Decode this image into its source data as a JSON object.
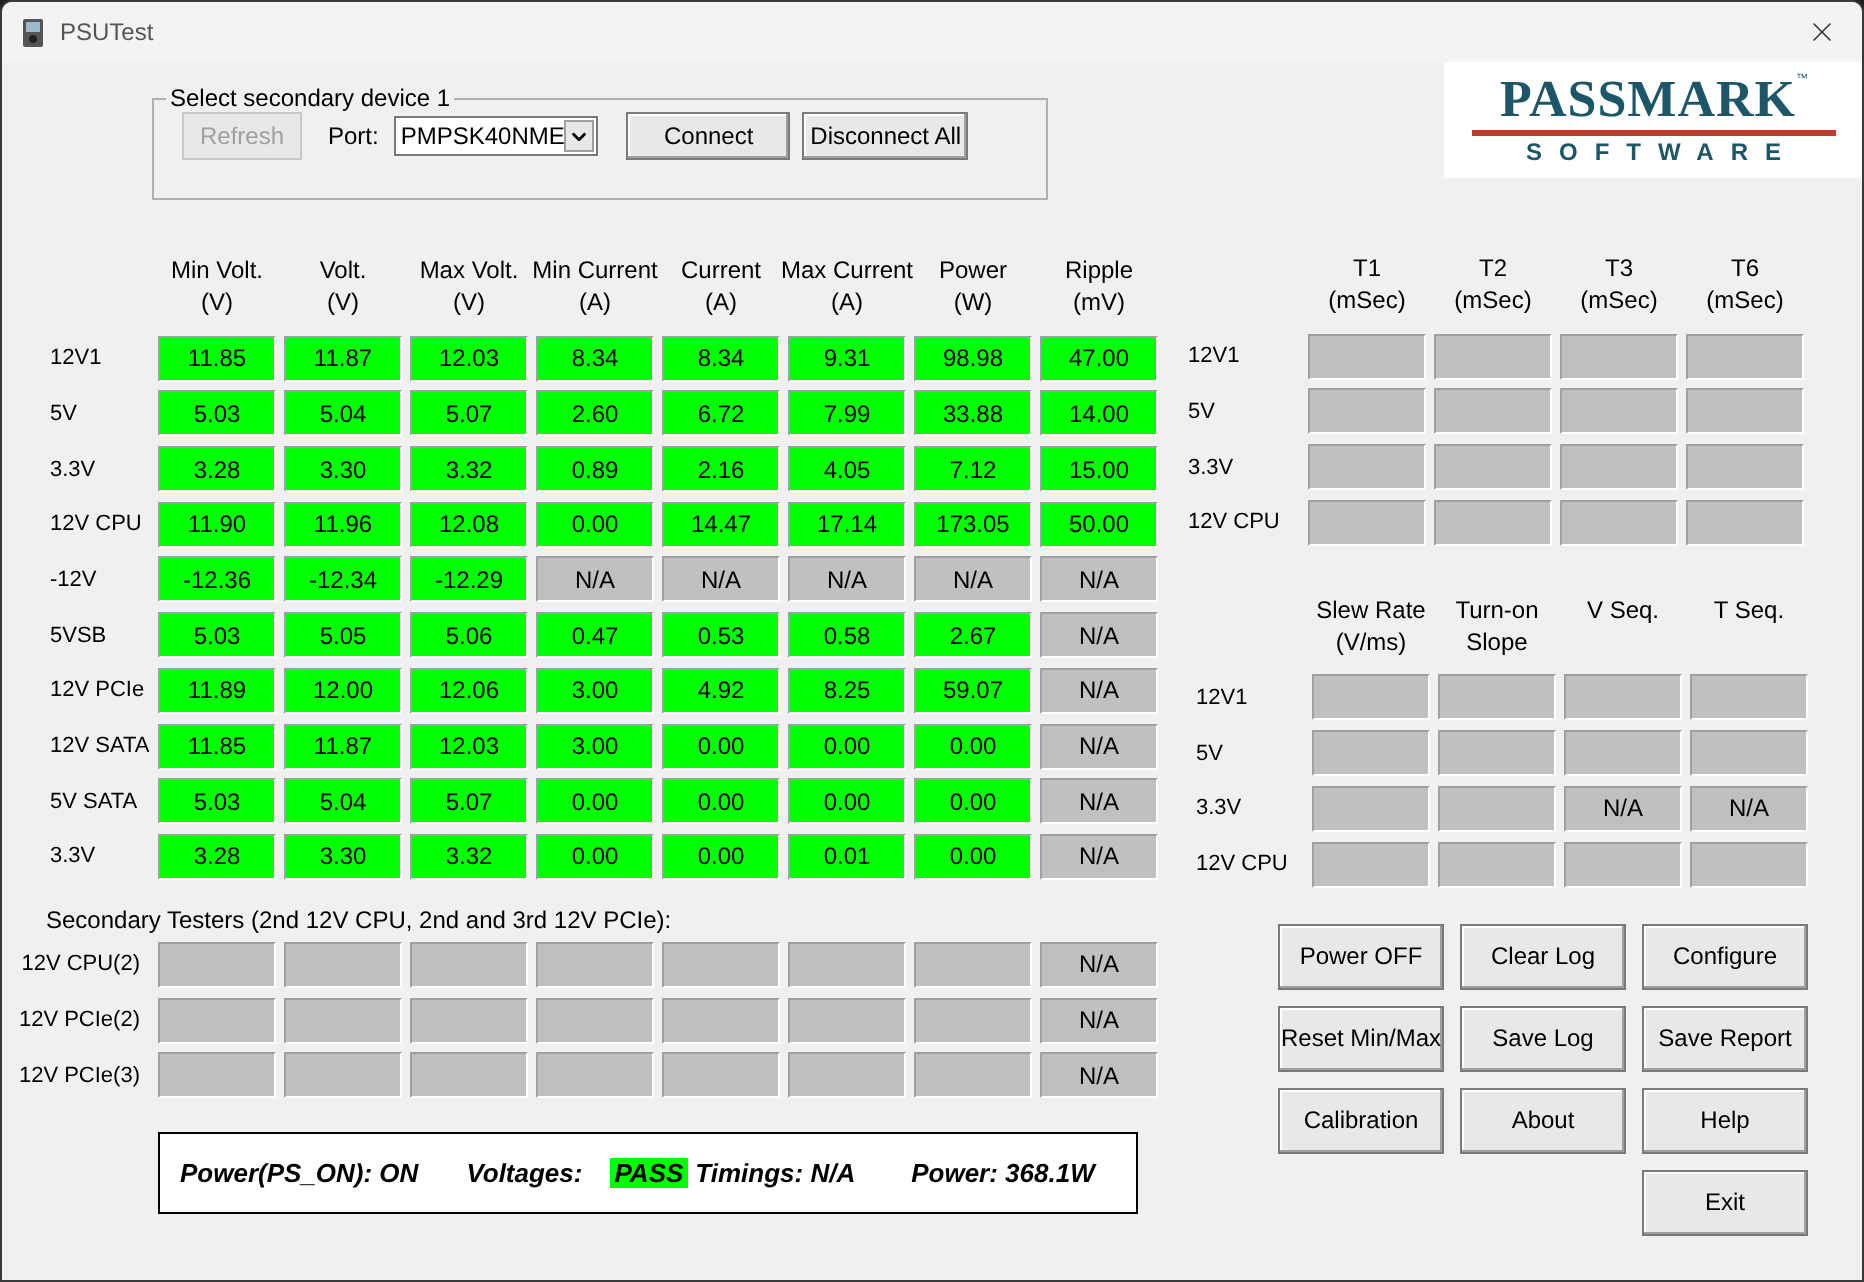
{
  "window": {
    "title": "PSUTest"
  },
  "device_group": {
    "title": "Select secondary device 1",
    "refresh": {
      "label": "Refresh",
      "disabled": true
    },
    "port_label": "Port:",
    "port_value": "PMPSK40NME",
    "connect": {
      "label": "Connect",
      "disabled": false
    },
    "disconnect": {
      "label": "Disconnect All",
      "disabled": false
    }
  },
  "logo": {
    "name": "PASSMARK",
    "mark": "™",
    "tagline": "SOFTWARE"
  },
  "readings": {
    "columns": [
      {
        "line1": "Min Volt.",
        "line2": "(V)"
      },
      {
        "line1": "Volt.",
        "line2": "(V)"
      },
      {
        "line1": "Max Volt.",
        "line2": "(V)"
      },
      {
        "line1": "Min Current",
        "line2": "(A)"
      },
      {
        "line1": "Current",
        "line2": "(A)"
      },
      {
        "line1": "Max Current",
        "line2": "(A)"
      },
      {
        "line1": "Power",
        "line2": "(W)"
      },
      {
        "line1": "Ripple",
        "line2": "(mV)"
      }
    ],
    "rows": [
      {
        "label": "12V1",
        "cells": [
          {
            "value": "11.85",
            "passed": true
          },
          {
            "value": "11.87",
            "passed": true
          },
          {
            "value": "12.03",
            "passed": true
          },
          {
            "value": "8.34",
            "passed": true
          },
          {
            "value": "8.34",
            "passed": true
          },
          {
            "value": "9.31",
            "passed": true
          },
          {
            "value": "98.98",
            "passed": true
          },
          {
            "value": "47.00",
            "passed": true
          }
        ]
      },
      {
        "label": "5V",
        "cells": [
          {
            "value": "5.03",
            "passed": true
          },
          {
            "value": "5.04",
            "passed": true
          },
          {
            "value": "5.07",
            "passed": true
          },
          {
            "value": "2.60",
            "passed": true
          },
          {
            "value": "6.72",
            "passed": true
          },
          {
            "value": "7.99",
            "passed": true
          },
          {
            "value": "33.88",
            "passed": true
          },
          {
            "value": "14.00",
            "passed": true
          }
        ]
      },
      {
        "label": "3.3V",
        "cells": [
          {
            "value": "3.28",
            "passed": true
          },
          {
            "value": "3.30",
            "passed": true
          },
          {
            "value": "3.32",
            "passed": true
          },
          {
            "value": "0.89",
            "passed": true
          },
          {
            "value": "2.16",
            "passed": true
          },
          {
            "value": "4.05",
            "passed": true
          },
          {
            "value": "7.12",
            "passed": true
          },
          {
            "value": "15.00",
            "passed": true
          }
        ]
      },
      {
        "label": "12V CPU",
        "cells": [
          {
            "value": "11.90",
            "passed": true
          },
          {
            "value": "11.96",
            "passed": true
          },
          {
            "value": "12.08",
            "passed": true
          },
          {
            "value": "0.00",
            "passed": true
          },
          {
            "value": "14.47",
            "passed": true
          },
          {
            "value": "17.14",
            "passed": true
          },
          {
            "value": "173.05",
            "passed": true
          },
          {
            "value": "50.00",
            "passed": true
          }
        ]
      },
      {
        "label": "-12V",
        "cells": [
          {
            "value": "-12.36",
            "passed": true
          },
          {
            "value": "-12.34",
            "passed": true
          },
          {
            "value": "-12.29",
            "passed": true
          },
          {
            "value": "N/A",
            "passed": false
          },
          {
            "value": "N/A",
            "passed": false
          },
          {
            "value": "N/A",
            "passed": false
          },
          {
            "value": "N/A",
            "passed": false
          },
          {
            "value": "N/A",
            "passed": false
          }
        ]
      },
      {
        "label": "5VSB",
        "cells": [
          {
            "value": "5.03",
            "passed": true
          },
          {
            "value": "5.05",
            "passed": true
          },
          {
            "value": "5.06",
            "passed": true
          },
          {
            "value": "0.47",
            "passed": true
          },
          {
            "value": "0.53",
            "passed": true
          },
          {
            "value": "0.58",
            "passed": true
          },
          {
            "value": "2.67",
            "passed": true
          },
          {
            "value": "N/A",
            "passed": false
          }
        ]
      },
      {
        "label": "12V PCIe",
        "cells": [
          {
            "value": "11.89",
            "passed": true
          },
          {
            "value": "12.00",
            "passed": true
          },
          {
            "value": "12.06",
            "passed": true
          },
          {
            "value": "3.00",
            "passed": true
          },
          {
            "value": "4.92",
            "passed": true
          },
          {
            "value": "8.25",
            "passed": true
          },
          {
            "value": "59.07",
            "passed": true
          },
          {
            "value": "N/A",
            "passed": false
          }
        ]
      },
      {
        "label": "12V SATA",
        "cells": [
          {
            "value": "11.85",
            "passed": true
          },
          {
            "value": "11.87",
            "passed": true
          },
          {
            "value": "12.03",
            "passed": true
          },
          {
            "value": "3.00",
            "passed": true
          },
          {
            "value": "0.00",
            "passed": true
          },
          {
            "value": "0.00",
            "passed": true
          },
          {
            "value": "0.00",
            "passed": true
          },
          {
            "value": "N/A",
            "passed": false
          }
        ]
      },
      {
        "label": "5V SATA",
        "cells": [
          {
            "value": "5.03",
            "passed": true
          },
          {
            "value": "5.04",
            "passed": true
          },
          {
            "value": "5.07",
            "passed": true
          },
          {
            "value": "0.00",
            "passed": true
          },
          {
            "value": "0.00",
            "passed": true
          },
          {
            "value": "0.00",
            "passed": true
          },
          {
            "value": "0.00",
            "passed": true
          },
          {
            "value": "N/A",
            "passed": false
          }
        ]
      },
      {
        "label": "3.3V",
        "cells": [
          {
            "value": "3.28",
            "passed": true
          },
          {
            "value": "3.30",
            "passed": true
          },
          {
            "value": "3.32",
            "passed": true
          },
          {
            "value": "0.00",
            "passed": true
          },
          {
            "value": "0.00",
            "passed": true
          },
          {
            "value": "0.01",
            "passed": true
          },
          {
            "value": "0.00",
            "passed": true
          },
          {
            "value": "N/A",
            "passed": false
          }
        ]
      }
    ]
  },
  "secondary": {
    "caption": "Secondary Testers (2nd 12V CPU, 2nd and 3rd 12V PCIe):",
    "rows": [
      {
        "label": "12V CPU(2)",
        "cells": [
          {
            "passed": false
          },
          {
            "passed": false
          },
          {
            "passed": false
          },
          {
            "passed": false
          },
          {
            "passed": false
          },
          {
            "passed": false
          },
          {
            "passed": false
          },
          {
            "value": "N/A",
            "passed": false
          }
        ]
      },
      {
        "label": "12V PCIe(2)",
        "cells": [
          {
            "passed": false
          },
          {
            "passed": false
          },
          {
            "passed": false
          },
          {
            "passed": false
          },
          {
            "passed": false
          },
          {
            "passed": false
          },
          {
            "passed": false
          },
          {
            "value": "N/A",
            "passed": false
          }
        ]
      },
      {
        "label": "12V PCIe(3)",
        "cells": [
          {
            "passed": false
          },
          {
            "passed": false
          },
          {
            "passed": false
          },
          {
            "passed": false
          },
          {
            "passed": false
          },
          {
            "passed": false
          },
          {
            "passed": false
          },
          {
            "value": "N/A",
            "passed": false
          }
        ]
      }
    ]
  },
  "timings": {
    "columns": [
      {
        "line1": "T1",
        "line2": "(mSec)"
      },
      {
        "line1": "T2",
        "line2": "(mSec)"
      },
      {
        "line1": "T3",
        "line2": "(mSec)"
      },
      {
        "line1": "T6",
        "line2": "(mSec)"
      }
    ],
    "rows": [
      {
        "label": "12V1",
        "cells": [
          {
            "passed": false
          },
          {
            "passed": false
          },
          {
            "passed": false
          },
          {
            "passed": false
          }
        ]
      },
      {
        "label": "5V",
        "cells": [
          {
            "passed": false
          },
          {
            "passed": false
          },
          {
            "passed": false
          },
          {
            "passed": false
          }
        ]
      },
      {
        "label": "3.3V",
        "cells": [
          {
            "passed": false
          },
          {
            "passed": false
          },
          {
            "passed": false
          },
          {
            "passed": false
          }
        ]
      },
      {
        "label": "12V CPU",
        "cells": [
          {
            "passed": false
          },
          {
            "passed": false
          },
          {
            "passed": false
          },
          {
            "passed": false
          }
        ]
      }
    ]
  },
  "sequence": {
    "columns": [
      {
        "line1": "Slew Rate",
        "line2": "(V/ms)"
      },
      {
        "line1": "Turn-on",
        "line2": "Slope"
      },
      {
        "line1": "V Seq."
      },
      {
        "line1": "T Seq."
      }
    ],
    "rows": [
      {
        "label": "12V1",
        "cells": [
          {
            "passed": false
          },
          {
            "passed": false
          },
          {
            "passed": false
          },
          {
            "passed": false
          }
        ]
      },
      {
        "label": "5V",
        "cells": [
          {
            "passed": false
          },
          {
            "passed": false
          },
          {
            "passed": false
          },
          {
            "passed": false
          }
        ]
      },
      {
        "label": "3.3V",
        "cells": [
          {
            "passed": false
          },
          {
            "passed": false
          },
          {
            "value": "N/A",
            "passed": false
          },
          {
            "value": "N/A",
            "passed": false
          }
        ]
      },
      {
        "label": "12V CPU",
        "cells": [
          {
            "passed": false
          },
          {
            "passed": false
          },
          {
            "passed": false
          },
          {
            "passed": false
          }
        ]
      }
    ]
  },
  "button_rows": [
    {
      "buttons": [
        "Power OFF",
        "Clear Log",
        "Configure"
      ]
    },
    {
      "buttons": [
        "Reset Min/Max",
        "Save Log",
        "Save Report"
      ]
    },
    {
      "buttons": [
        "Calibration",
        "About",
        "Help"
      ]
    },
    {
      "buttons": [
        "Exit"
      ]
    }
  ],
  "status_bar": {
    "power": "Power(PS_ON): ON",
    "voltages_label": "Voltages:",
    "voltages_result": "PASS",
    "voltages_pass": true,
    "timings": "Timings: N/A",
    "total": "Power: 368.1W"
  }
}
